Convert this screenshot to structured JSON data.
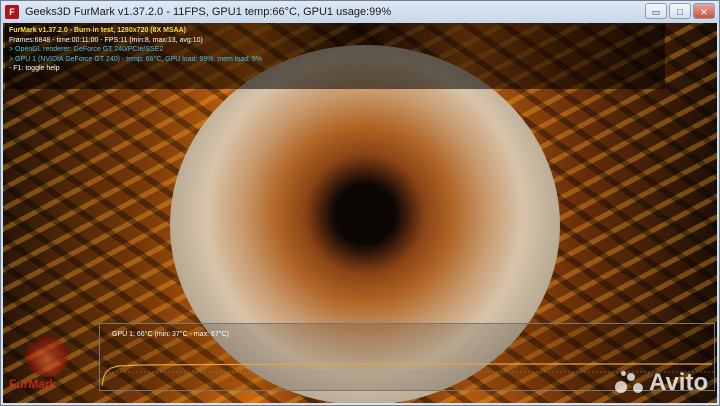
{
  "window": {
    "title": "Geeks3D FurMark v1.37.2.0 - 11FPS, GPU1 temp:66°C, GPU1 usage:99%",
    "icon_name": "furmark-app-icon",
    "buttons": {
      "minimize": "▭",
      "maximize": "□",
      "close": "✕"
    }
  },
  "osd": {
    "line1": "FurMark v1.37.2.0 - Burn-in test, 1280x720 (8X MSAA)",
    "line2": "Frames:6848 - time:00:11:00 - FPS:11 (min:8, max:13, avg:10)",
    "line3": "> OpenGL renderer: GeForce GT 240/PCIe/SSE2",
    "line4": "> GPU 1 (NVIDIA GeForce GT 240) - temp: 66°C, GPU load: 99%, mem load: 9%",
    "line5": "- F1: toggle help"
  },
  "temp_graph": {
    "label": "GPU 1: 66°C (min: 37°C - max: 67°C)",
    "line_color": "#e8a340"
  },
  "logo": {
    "text": "FurMark"
  },
  "watermark": {
    "text": "Avito"
  }
}
